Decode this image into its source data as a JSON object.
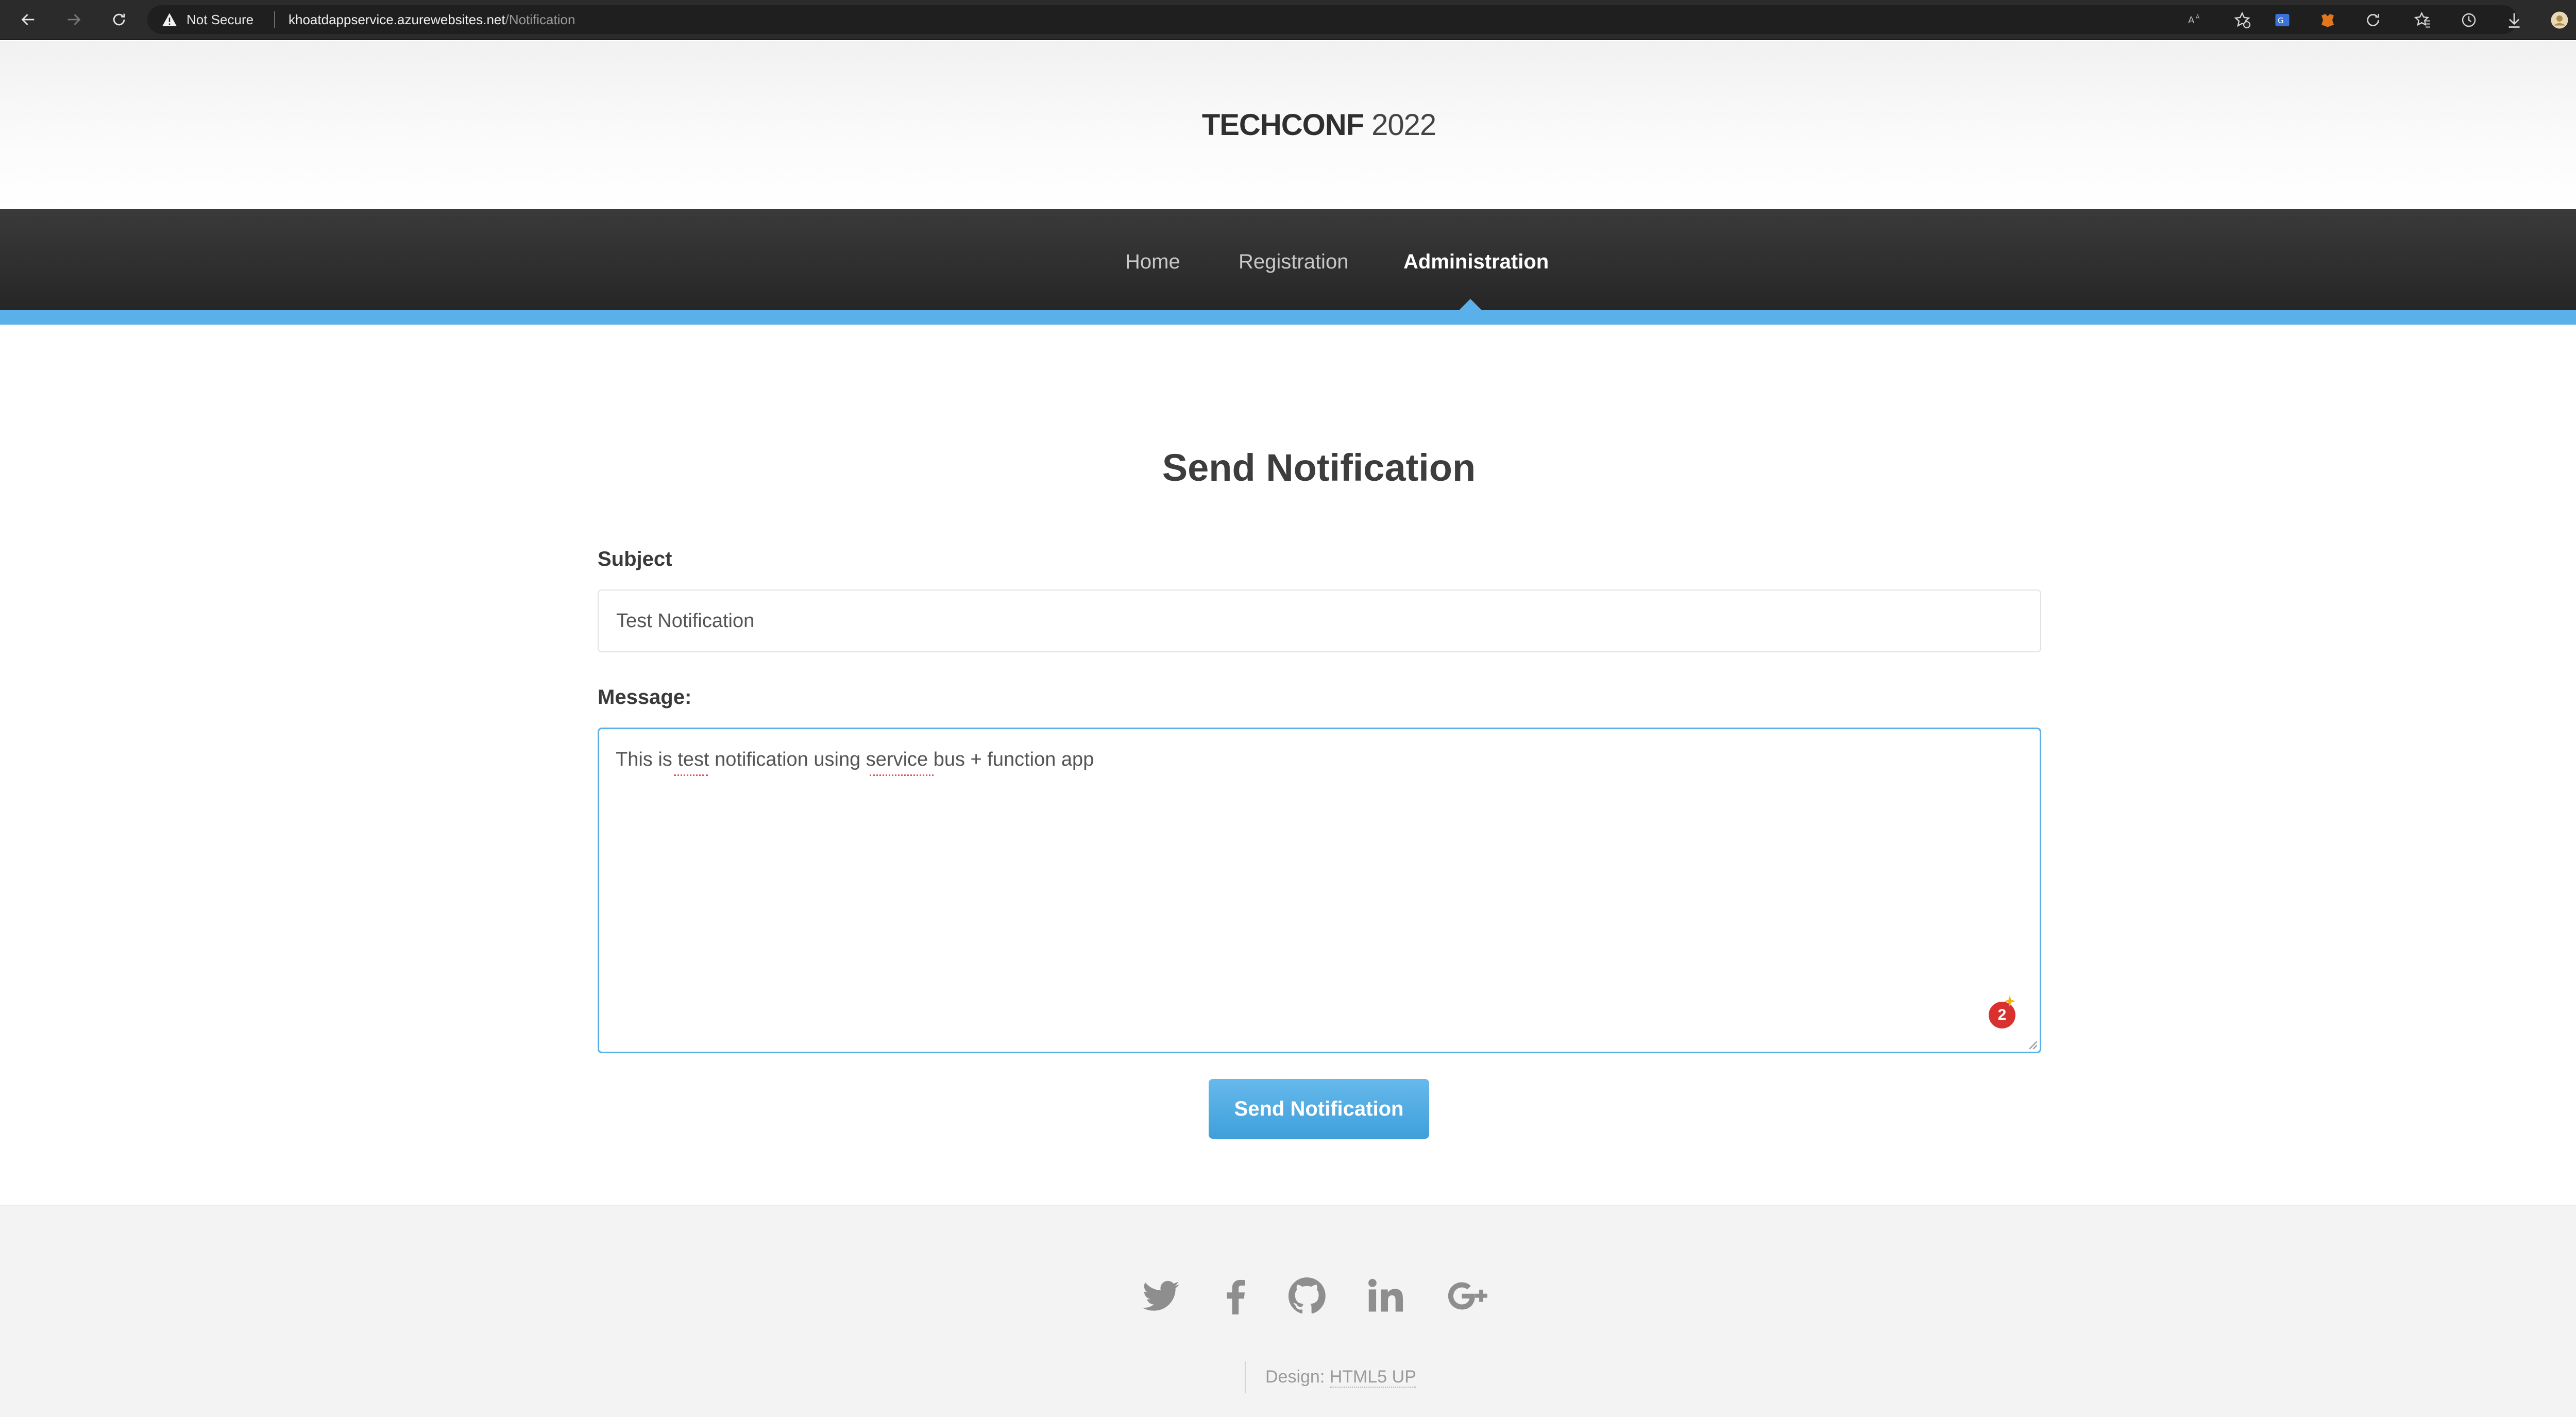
{
  "browser": {
    "security_label": "Not Secure",
    "url_host": "khoatdappservice.azurewebsites.net",
    "url_path": "/Notification",
    "icons": [
      "back-icon",
      "forward-icon",
      "reload-icon",
      "warning-icon",
      "read-aloud-icon",
      "add-favorite-icon",
      "translate-icon",
      "extension-icon",
      "sync-icon",
      "favorites-icon",
      "history-icon",
      "downloads-icon",
      "profile-avatar",
      "more-icon"
    ]
  },
  "site": {
    "brand": "TECHCONF",
    "year": "2022",
    "nav": [
      {
        "label": "Home",
        "active": false
      },
      {
        "label": "Registration",
        "active": false
      },
      {
        "label": "Administration",
        "active": true
      }
    ]
  },
  "form": {
    "title": "Send Notification",
    "subject_label": "Subject",
    "subject_value": "Test Notification",
    "message_label": "Message:",
    "message_value": "This is test notification using service bus + function app",
    "grammar_badge_count": "2",
    "submit_label": "Send Notification"
  },
  "footer": {
    "social": [
      "twitter-icon",
      "facebook-icon",
      "github-icon",
      "linkedin-icon",
      "google-plus-icon"
    ],
    "credit_prefix": "Design: ",
    "credit_link": "HTML5 UP"
  },
  "colors": {
    "accent": "#5ab0e8",
    "navbar": "#2b2b2b",
    "footer_bg": "#f3f3f3",
    "badge": "#d93030"
  }
}
